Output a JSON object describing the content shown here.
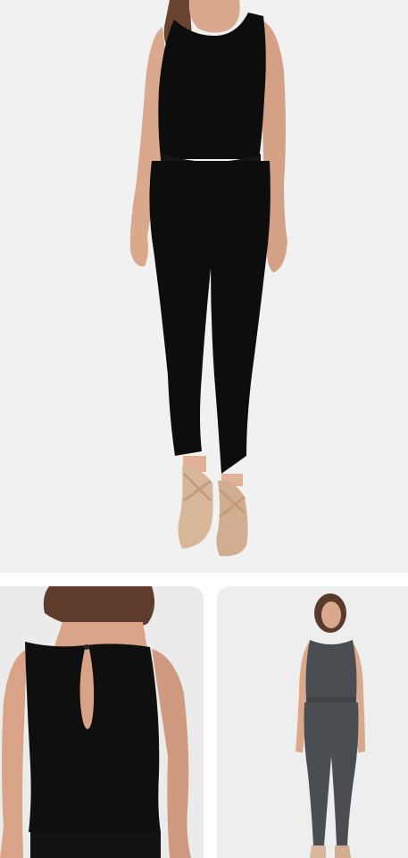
{
  "gallery": {
    "main_image": {
      "alt": "",
      "garment_color": "#0d0d0d",
      "background": "#f1f1f1"
    },
    "thumbnails": [
      {
        "alt": "",
        "garment_color": "#0f0f0f",
        "background": "#ebebeb"
      },
      {
        "alt": "",
        "garment_color": "#4a4d52",
        "background": "#eeeeee"
      }
    ]
  }
}
